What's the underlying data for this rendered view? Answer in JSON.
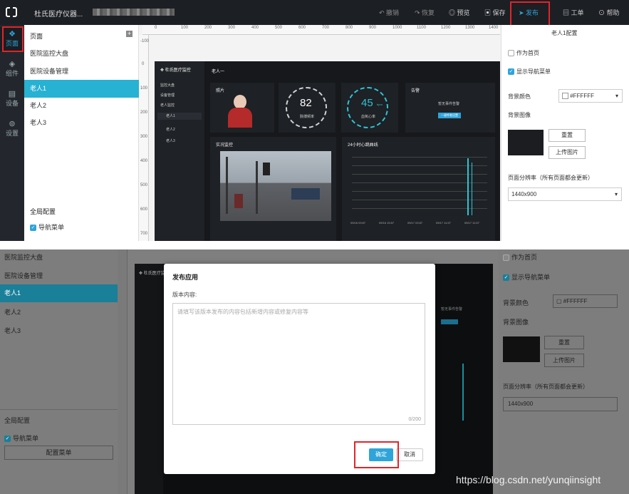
{
  "topbar": {
    "app_title": "杜氏医疗仪器...",
    "actions": {
      "undo": "撤销",
      "redo": "恢复",
      "preview": "预览",
      "save": "保存",
      "publish": "发布",
      "work_order": "工单",
      "help": "帮助"
    }
  },
  "rail": [
    {
      "label": "页面",
      "icon": "layers-icon"
    },
    {
      "label": "组件",
      "icon": "cube-icon"
    },
    {
      "label": "设备",
      "icon": "device-icon"
    },
    {
      "label": "设置",
      "icon": "gear-icon"
    }
  ],
  "pagelist": {
    "header": "页面",
    "items": [
      "医院监控大盘",
      "医院设备管理",
      "老人1",
      "老人2",
      "老人3"
    ],
    "selected": "老人1",
    "global_config": "全局配置",
    "nav_menu_check": "导航菜单",
    "config_menu_button": "配置菜单"
  },
  "ruler": {
    "h_ticks": [
      "0",
      "100",
      "200",
      "300",
      "400",
      "500",
      "600",
      "700",
      "800",
      "900",
      "1000",
      "1100",
      "1200",
      "1300",
      "1400"
    ],
    "v_ticks": [
      "-100",
      "0",
      "100",
      "200",
      "300",
      "400",
      "500",
      "600",
      "700"
    ]
  },
  "canvas": {
    "logo_title": "杜氏医疗监控",
    "page_title": "老人一",
    "side_items": [
      "监控大盘",
      "设备管理",
      "老人监控",
      "老人1",
      "老人2",
      "老人3"
    ],
    "cards": {
      "photo": "照片",
      "heart_value": "82",
      "heart_label": "脉搏频率",
      "bpm_value": "45",
      "bpm_unit": "bpm",
      "bpm_label": "血氧心率",
      "alarm": "告警",
      "alarm_text": "暂无事件告警",
      "alarm_button": "一键呼救设置",
      "live": "实况监控",
      "curve": "24小时心跳曲线"
    },
    "curve_x": [
      "09/16 03:57",
      "09/16 15:57",
      "09/17 03:57",
      "09/17 11:57",
      "09/17 11:57"
    ]
  },
  "config": {
    "title": "老人1配置",
    "as_home": "作为首页",
    "show_nav": "显示导航菜单",
    "bg_color_label": "背景颜色",
    "bg_color_value": "#FFFFFF",
    "bg_image_label": "背景图像",
    "reset": "重置",
    "upload": "上传图片",
    "resolution_label": "页面分辨率（所有页面都会更新）",
    "resolution_value": "1440x900"
  },
  "modal": {
    "title": "发布应用",
    "version_label": "版本内容:",
    "placeholder": "请填写该版本发布的内容包括新增内容或修复内容等",
    "counter": "0/200",
    "confirm": "确定",
    "cancel": "取消"
  },
  "watermark": "https://blog.csdn.net/yunqiinsight",
  "colors": {
    "accent": "#2ea4d9",
    "highlight": "#e0252b",
    "selected_row": "#27b1d2"
  }
}
